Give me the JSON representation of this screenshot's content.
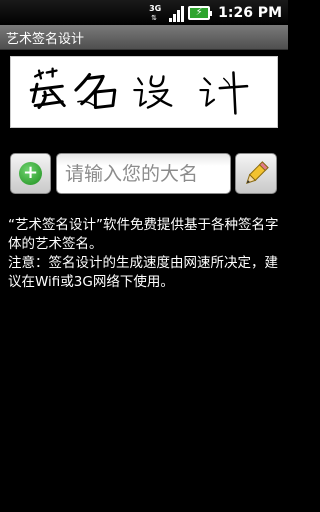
{
  "status_bar": {
    "network": "3G",
    "time": "1:26 PM",
    "icons": [
      "3g-data-icon",
      "signal-icon",
      "battery-charging-icon"
    ]
  },
  "app": {
    "title": "艺术签名设计"
  },
  "signature_preview": {
    "text": "签名设计"
  },
  "input": {
    "placeholder": "请输入您的大名",
    "value": ""
  },
  "buttons": {
    "add_icon": "plus-circle-icon",
    "edit_icon": "pencil-icon"
  },
  "description": {
    "line1": "“艺术签名设计”软件免费提供基于各种签名字体的艺术签名。",
    "line2": "注意：签名设计的生成速度由网速所决定，建议在Wifi或3G网络下使用。"
  },
  "colors": {
    "background": "#000000",
    "title_bar": "#5f5f5f",
    "add_icon": "#2aa52a",
    "pencil": "#f2c230"
  }
}
